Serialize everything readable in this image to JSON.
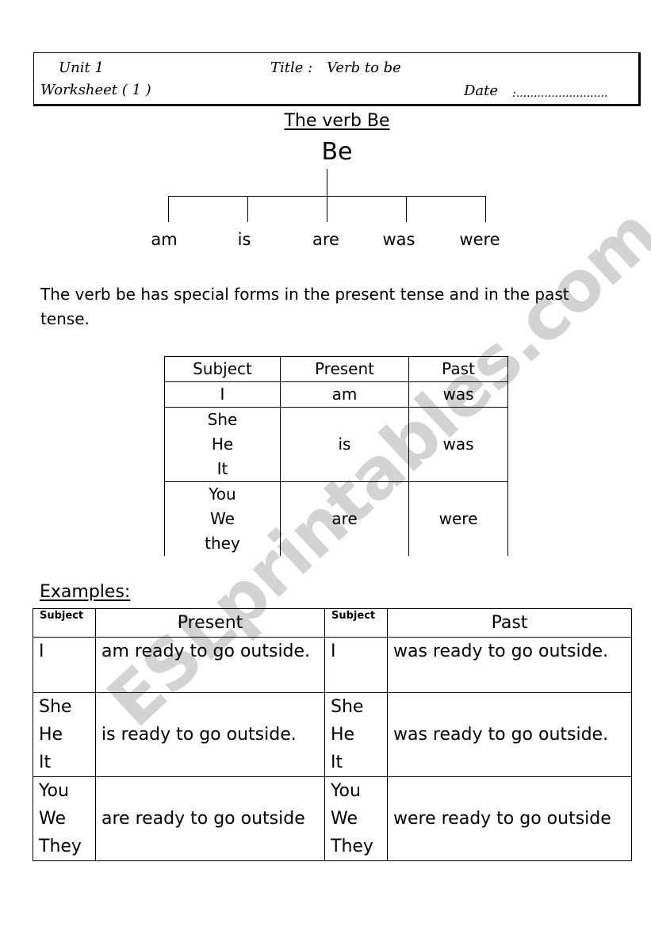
{
  "header": {
    "unit": "Unit 1",
    "title_label": "Title :",
    "title_value": "Verb to be",
    "worksheet": "Worksheet ( 1 )",
    "date_label": "Date",
    "date_value": ":.........................."
  },
  "diagram": {
    "heading": "The verb Be",
    "root": "Be",
    "forms": [
      "am",
      "is",
      "are",
      "was",
      "were"
    ]
  },
  "intro_text": "The verb be has special forms in the present tense and in the past tense.",
  "forms_table": {
    "headers": [
      "Subject",
      "Present",
      "Past"
    ],
    "rows": [
      {
        "subjects": [
          "I"
        ],
        "present": "am",
        "past": "was"
      },
      {
        "subjects": [
          "She",
          "He",
          "It"
        ],
        "present": "is",
        "past": "was"
      },
      {
        "subjects": [
          "You",
          "We",
          "they"
        ],
        "present": "are",
        "past": "were"
      }
    ]
  },
  "examples": {
    "label": "Examples:",
    "headers": [
      "Subject",
      "Present",
      "Subject",
      "Past"
    ],
    "rows": [
      {
        "subjects": [
          "I"
        ],
        "present": "am ready to go outside.",
        "past": "was ready to go outside."
      },
      {
        "subjects": [
          "She",
          "He",
          "It"
        ],
        "present": "is ready to go outside.",
        "past": "was ready to go outside."
      },
      {
        "subjects": [
          "You",
          "We",
          "They"
        ],
        "present": "are ready to go outside",
        "past": "were ready to go outside"
      }
    ]
  },
  "watermark": "ESLprintables.com"
}
